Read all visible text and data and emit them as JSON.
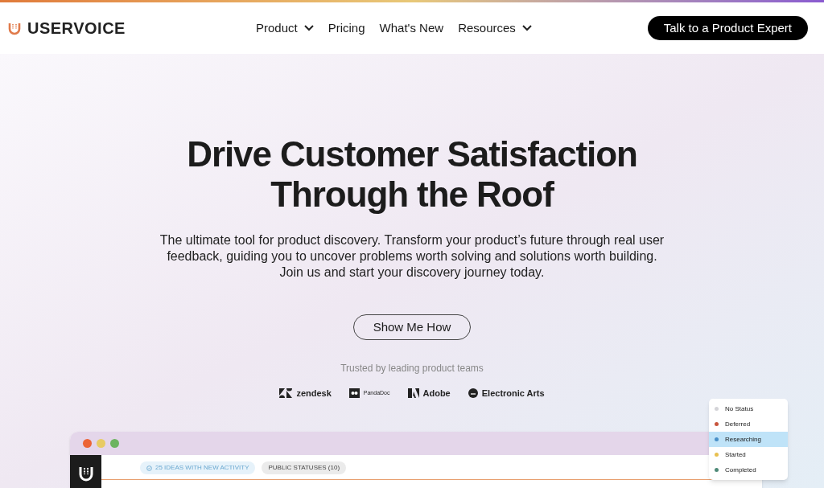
{
  "header": {
    "brand": "USERVOICE",
    "nav": [
      {
        "label": "Product",
        "dropdown": true
      },
      {
        "label": "Pricing",
        "dropdown": false
      },
      {
        "label": "What's New",
        "dropdown": false
      },
      {
        "label": "Resources",
        "dropdown": true
      }
    ],
    "cta": "Talk to a Product Expert"
  },
  "hero": {
    "title_lines": [
      "Drive Customer Satisfaction",
      "Through the Roof"
    ],
    "subtitle_lines": [
      "The ultimate tool for product discovery. Transform your product’s future through real user",
      "feedback, guiding you to uncover problems worth solving and solutions worth building.",
      "Join us and start your discovery journey today."
    ],
    "button": "Show Me How",
    "trusted": "Trusted by leading product teams"
  },
  "logos": [
    {
      "kind": "zendesk",
      "label": "zendesk"
    },
    {
      "kind": "pandadoc",
      "label": "PandaDoc"
    },
    {
      "kind": "adobe",
      "label": "Adobe"
    },
    {
      "kind": "ea",
      "label": "Electronic Arts"
    }
  ],
  "app": {
    "badges": [
      {
        "label": "25 IDEAS WITH NEW ACTIVITY",
        "kind": "activity"
      },
      {
        "label": "PUBLIC STATUSES (10)",
        "kind": "plain"
      }
    ]
  },
  "status_menu": [
    {
      "label": "No Status",
      "color": "#d4d4d8",
      "selected": false
    },
    {
      "label": "Deferred",
      "color": "#c8553d",
      "selected": false
    },
    {
      "label": "Researching",
      "color": "#4a90c8",
      "selected": true
    },
    {
      "label": "Started",
      "color": "#e8c050",
      "selected": false
    },
    {
      "label": "Completed",
      "color": "#4f8a78",
      "selected": false
    }
  ]
}
